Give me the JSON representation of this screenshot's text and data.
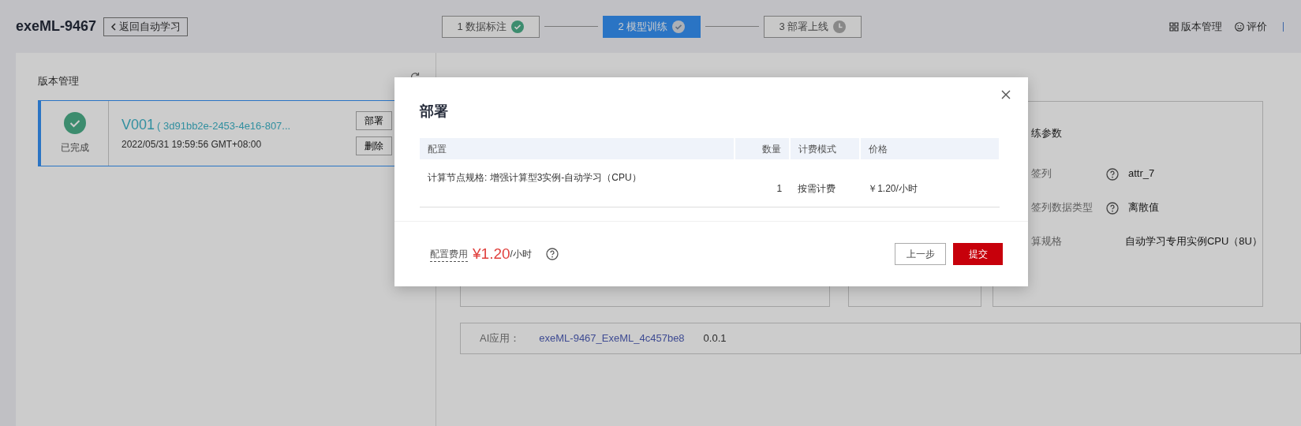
{
  "header": {
    "title": "exeML-9467",
    "back_button": "返回自动学习",
    "steps": [
      {
        "number": "1",
        "label": "数据标注",
        "complete": true,
        "selected": false
      },
      {
        "number": "2",
        "label": "模型训练",
        "complete": true,
        "selected": true
      },
      {
        "number": "3",
        "label": "部署上线",
        "complete": false,
        "selected": false
      }
    ],
    "links": [
      {
        "kind": "grid",
        "label": "版本管理"
      },
      {
        "kind": "smile",
        "label": "评价"
      }
    ]
  },
  "version_panel": {
    "title": "版本管理",
    "versions": [
      {
        "status": "已完成",
        "name": "V001",
        "id": "( 3d91bb2e-2453-4e16-807...",
        "time": "2022/05/31 19:59:56 GMT+08:00",
        "selected": true,
        "actions": [
          "部署",
          "删除"
        ]
      }
    ]
  },
  "details": {
    "params_title": "练参数",
    "params": [
      {
        "label": "签列",
        "help": true,
        "value": "attr_7"
      },
      {
        "label": "签列数据类型",
        "help": true,
        "value": "离散值"
      },
      {
        "label": "算规格",
        "help": false,
        "value": "自动学习专用实例CPU（8U）"
      }
    ],
    "ai_app": {
      "label": "AI应用：",
      "name": "exeML-9467_ExeML_4c457be8",
      "version": "0.0.1"
    }
  },
  "dialog": {
    "title": "部署",
    "table": {
      "columns": [
        "配置",
        "数量",
        "计费模式",
        "价格"
      ],
      "rows": [
        [
          "计算节点规格: 增强计算型3实例-自动学习（CPU）",
          "1",
          "按需计费",
          "￥1.20/小时"
        ]
      ]
    },
    "fee_label": "配置费用",
    "fee": "¥1.20",
    "fee_unit": "/小时",
    "buttons": [
      {
        "label": "上一步",
        "kind": "secondary"
      },
      {
        "label": "提交",
        "kind": "primary"
      }
    ]
  }
}
